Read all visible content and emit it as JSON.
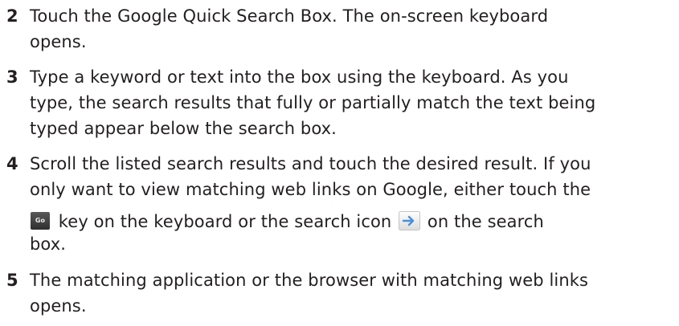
{
  "steps": [
    {
      "number": "2",
      "lines": [
        "Touch the Google Quick Search Box. The on-screen keyboard",
        "opens."
      ]
    },
    {
      "number": "3",
      "lines": [
        "Type a keyword or text into the box using the keyboard. As you",
        "type, the search results that fully or partially match the text being",
        "typed appear below the search box."
      ]
    },
    {
      "number": "4",
      "lines": [
        "Scroll the listed search results and touch the desired result. If you",
        "only want to view matching web links on Google, either touch the"
      ],
      "go_key_label": "Go",
      "inline_text_a": "key on the keyboard or the search icon",
      "inline_text_b": "on the search",
      "last_line": "box."
    },
    {
      "number": "5",
      "lines": [
        "The matching application or the browser with matching web links",
        "opens."
      ]
    }
  ],
  "colors": {
    "text": "#231f20",
    "go_key_bg": "#3c3c3c",
    "search_icon_arrow": "#4a90d9"
  },
  "icons": {
    "go_key": "go-key-icon",
    "search": "search-arrow-icon"
  }
}
